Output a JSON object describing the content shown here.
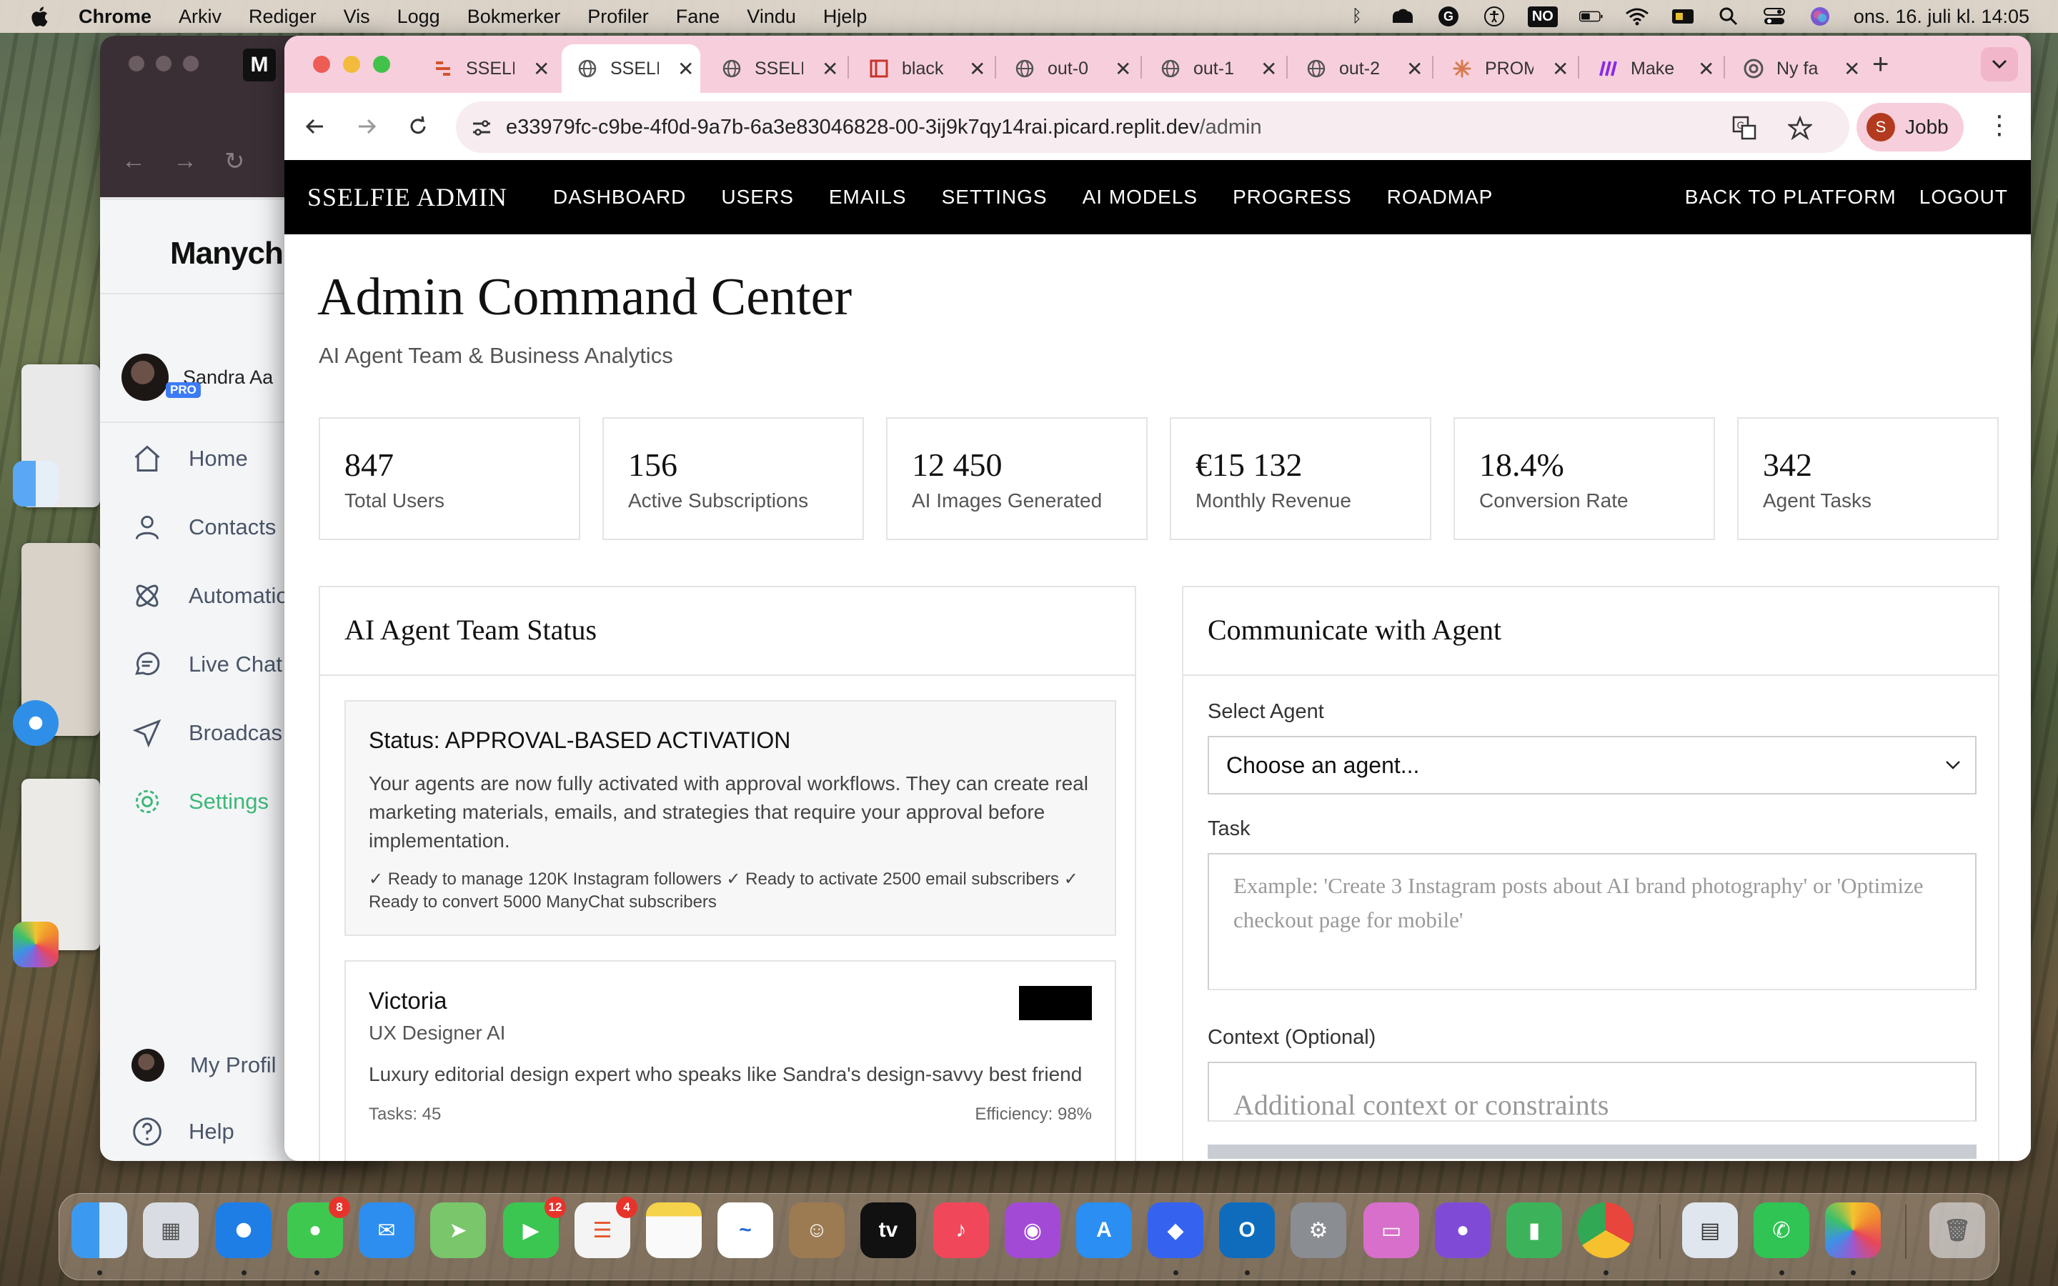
{
  "menubar": {
    "app": "Chrome",
    "items": [
      "Arkiv",
      "Rediger",
      "Vis",
      "Logg",
      "Bokmerker",
      "Profiler",
      "Fane",
      "Vindu",
      "Hjelp"
    ],
    "input_badge": "NO",
    "clock": "ons. 16. juli kl. 14:05"
  },
  "background_window": {
    "logo": "Manych",
    "user_name": "Sandra Aa",
    "pro_badge": "PRO",
    "nav": [
      "Home",
      "Contacts",
      "Automatio",
      "Live Chat",
      "Broadcas",
      "Settings"
    ],
    "active_nav": "Settings",
    "bottom": [
      "My Profil",
      "Help"
    ]
  },
  "browser": {
    "tabs": [
      {
        "title": "SSELI",
        "icon": "sselfie-favicon"
      },
      {
        "title": "SSELI",
        "icon": "globe-icon",
        "active": true
      },
      {
        "title": "SSELI",
        "icon": "globe-icon"
      },
      {
        "title": "black",
        "icon": "red-doc-icon"
      },
      {
        "title": "out-0",
        "icon": "globe-icon"
      },
      {
        "title": "out-1",
        "icon": "globe-icon"
      },
      {
        "title": "out-2",
        "icon": "globe-icon"
      },
      {
        "title": "PROM",
        "icon": "claude-icon"
      },
      {
        "title": "Make",
        "icon": "make-icon"
      },
      {
        "title": "Ny fa",
        "icon": "chrome-icon"
      }
    ],
    "url_host": "e33979fc-c9be-4f0d-9a7b-6a3e83046828-00-3ij9k7qy14rai.picard.replit.dev",
    "url_path": "/admin",
    "profile_initial": "S",
    "profile_name": "Jobb"
  },
  "admin_nav": {
    "brand": "SSELFIE ADMIN",
    "links": [
      "DASHBOARD",
      "USERS",
      "EMAILS",
      "SETTINGS",
      "AI MODELS",
      "PROGRESS",
      "ROADMAP"
    ],
    "right": [
      "BACK TO PLATFORM",
      "LOGOUT"
    ]
  },
  "header": {
    "title": "Admin Command Center",
    "subtitle": "AI Agent Team & Business Analytics"
  },
  "stats": [
    {
      "value": "847",
      "label": "Total Users"
    },
    {
      "value": "156",
      "label": "Active Subscriptions"
    },
    {
      "value": "12 450",
      "label": "AI Images Generated"
    },
    {
      "value": "€15 132",
      "label": "Monthly Revenue"
    },
    {
      "value": "18.4%",
      "label": "Conversion Rate"
    },
    {
      "value": "342",
      "label": "Agent Tasks"
    }
  ],
  "team_panel": {
    "title": "AI Agent Team Status",
    "status_title": "Status: APPROVAL-BASED ACTIVATION",
    "status_desc": "Your agents are now fully activated with approval workflows. They can create real marketing materials, emails, and strategies that require your approval before implementation.",
    "status_ready": "✓ Ready to manage 120K Instagram followers ✓ Ready to activate 2500 email subscribers ✓ Ready to convert 5000 ManyChat subscribers",
    "agent": {
      "name": "Victoria",
      "role": "UX Designer AI",
      "desc": "Luxury editorial design expert who speaks like Sandra's design-savvy best friend",
      "tasks": "Tasks: 45",
      "efficiency": "Efficiency: 98%"
    }
  },
  "comm_panel": {
    "title": "Communicate with Agent",
    "select_label": "Select Agent",
    "select_value": "Choose an agent...",
    "task_label": "Task",
    "task_placeholder": "Example: 'Create 3 Instagram posts about AI brand photography' or 'Optimize checkout page for mobile'",
    "context_label": "Context (Optional)",
    "context_placeholder": "Additional context or constraints"
  },
  "dock": {
    "badges": {
      "messages": "8",
      "facetime": "12",
      "reminders": "4"
    }
  }
}
